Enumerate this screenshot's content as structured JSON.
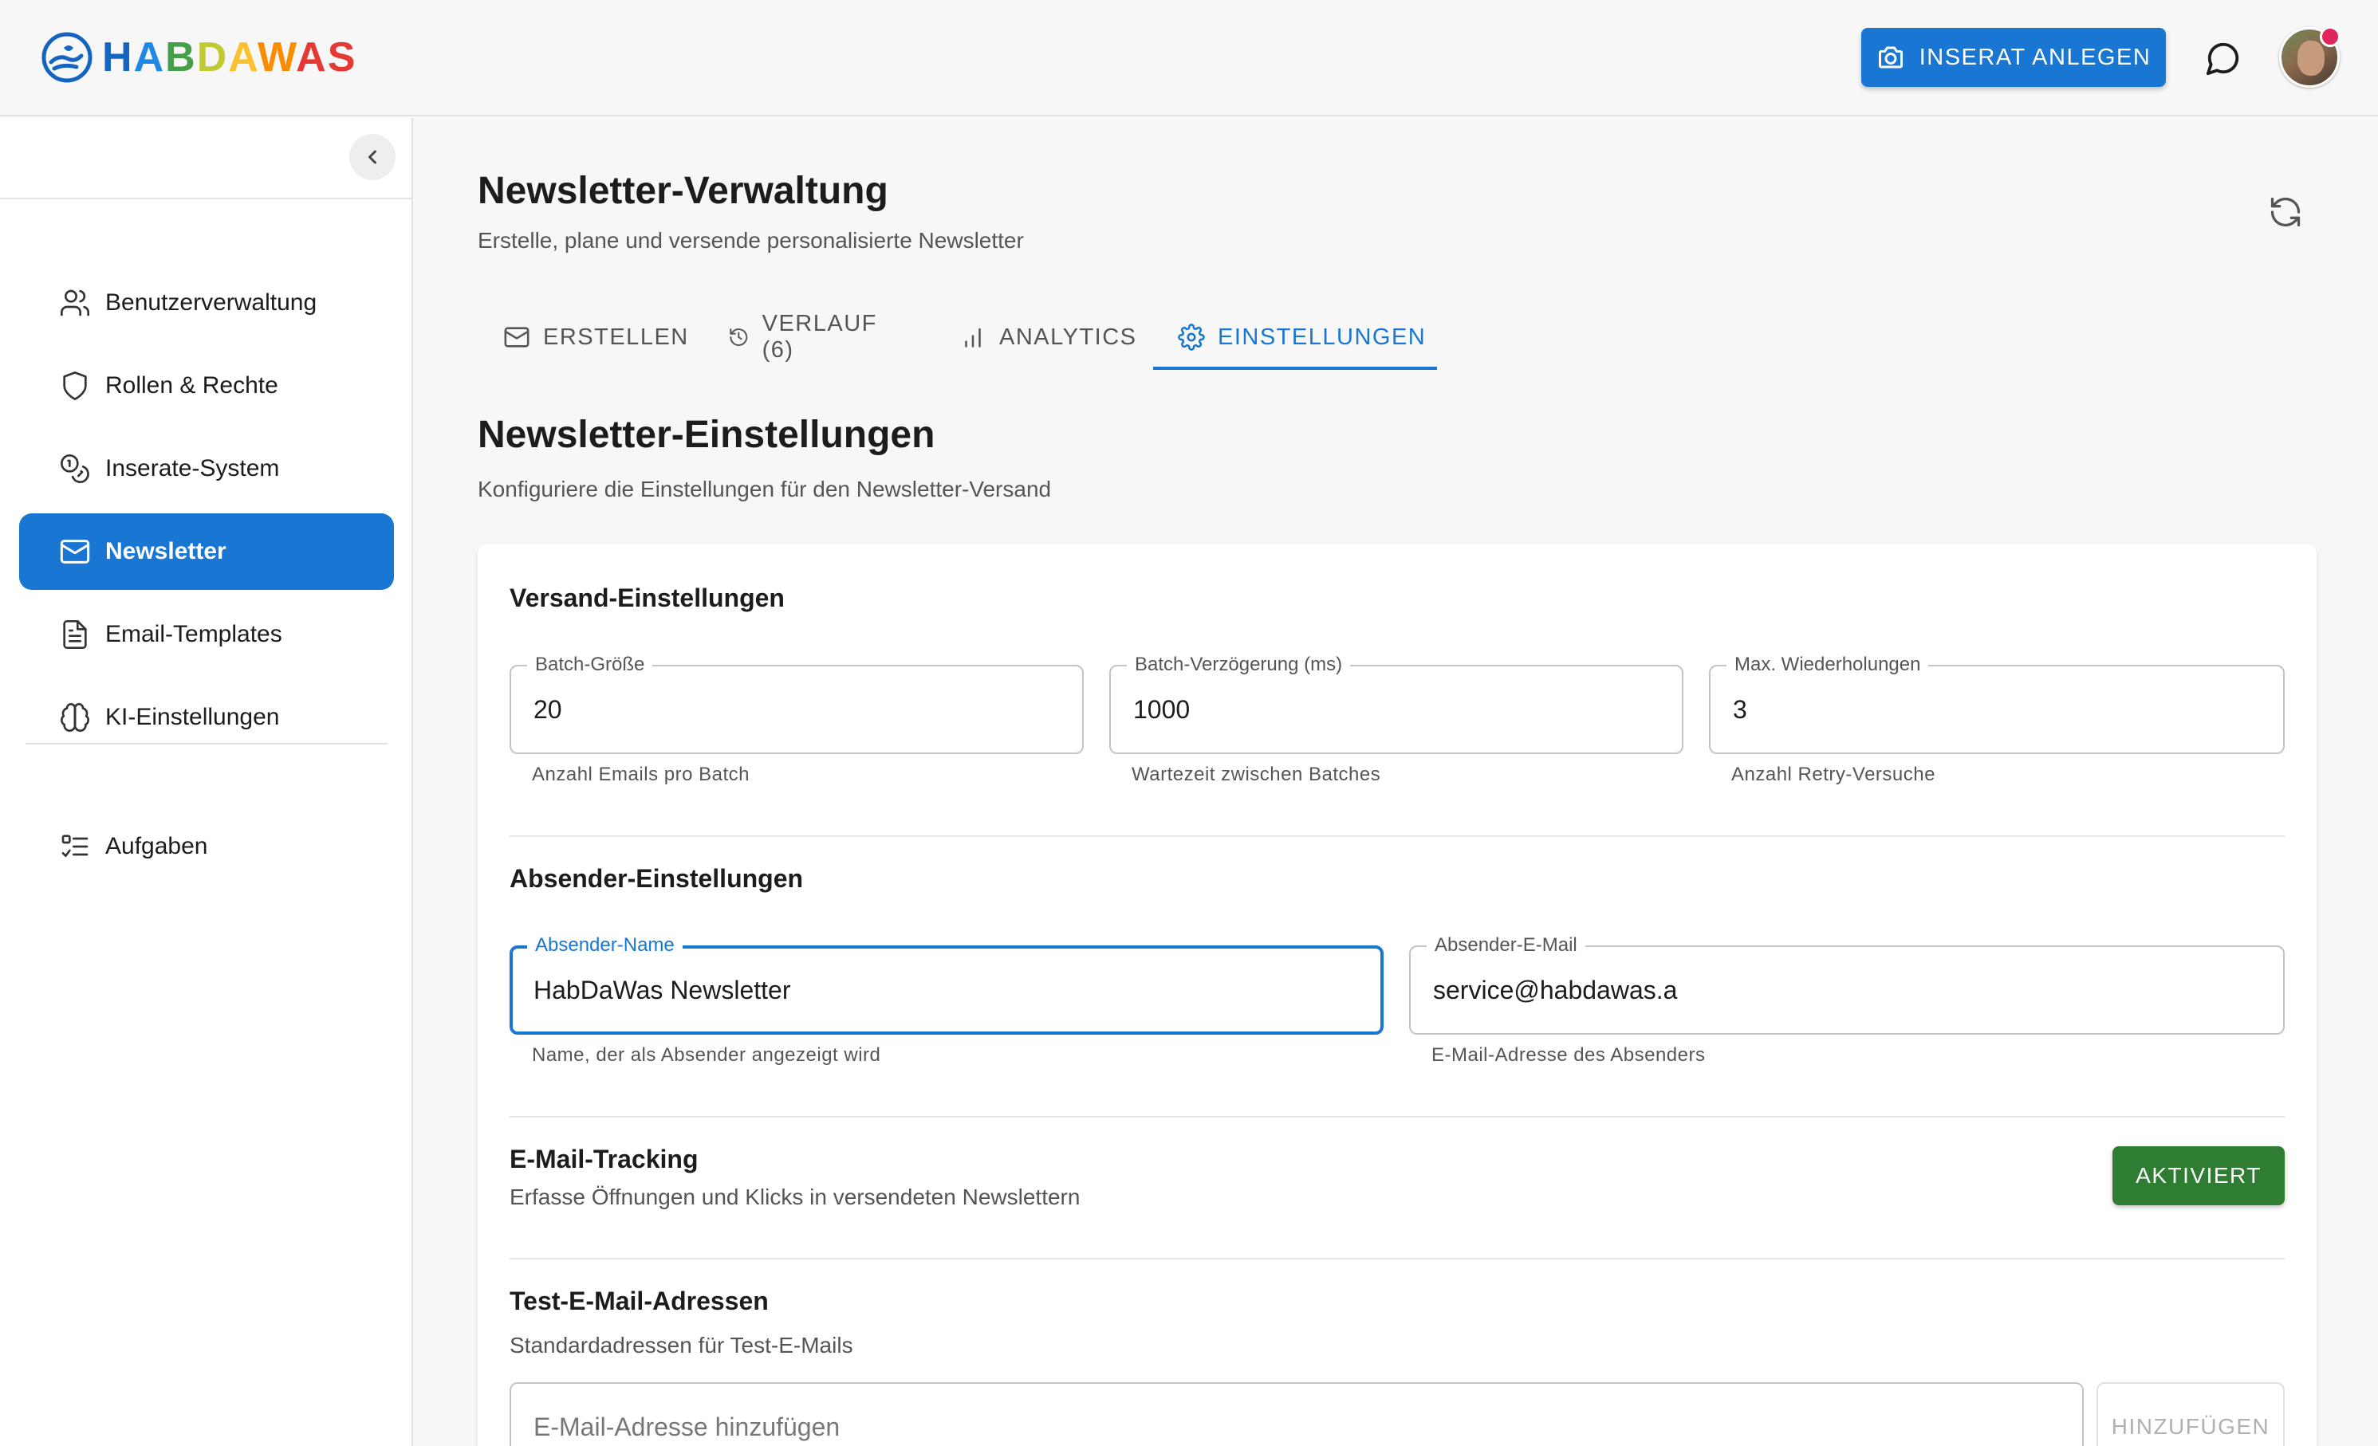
{
  "header": {
    "brand": "HABDAWAS",
    "brand_letters": [
      {
        "ch": "H",
        "color": "#1565c0"
      },
      {
        "ch": "A",
        "color": "#1e88e5"
      },
      {
        "ch": "B",
        "color": "#43a047"
      },
      {
        "ch": "D",
        "color": "#c0ca33"
      },
      {
        "ch": "A",
        "color": "#fbc02d"
      },
      {
        "ch": "W",
        "color": "#fb8c00"
      },
      {
        "ch": "A",
        "color": "#e53935"
      },
      {
        "ch": "S",
        "color": "#e53935"
      }
    ],
    "create_listing_label": "INSERAT ANLEGEN"
  },
  "sidebar": {
    "items": [
      {
        "label": "Benutzerverwaltung",
        "icon": "users-icon"
      },
      {
        "label": "Rollen & Rechte",
        "icon": "shield-icon"
      },
      {
        "label": "Inserate-System",
        "icon": "coins-icon"
      },
      {
        "label": "Newsletter",
        "icon": "mail-icon",
        "active": true
      },
      {
        "label": "Email-Templates",
        "icon": "document-icon"
      },
      {
        "label": "KI-Einstellungen",
        "icon": "brain-icon"
      },
      {
        "label": "Aufgaben",
        "icon": "checklist-icon"
      }
    ]
  },
  "main": {
    "title": "Newsletter-Verwaltung",
    "subtitle": "Erstelle, plane und versende personalisierte Newsletter",
    "tabs": [
      {
        "label": "ERSTELLEN",
        "icon": "mail-icon"
      },
      {
        "label": "VERLAUF (6)",
        "icon": "history-icon"
      },
      {
        "label": "ANALYTICS",
        "icon": "bar-chart-icon"
      },
      {
        "label": "EINSTELLUNGEN",
        "icon": "gear-icon",
        "active": true
      }
    ],
    "settings_title": "Newsletter-Einstellungen",
    "settings_subtitle": "Konfiguriere die Einstellungen für den Newsletter-Versand"
  },
  "versand": {
    "title": "Versand-Einstellungen",
    "batch_size": {
      "label": "Batch-Größe",
      "value": "20",
      "helper": "Anzahl Emails pro Batch"
    },
    "batch_delay": {
      "label": "Batch-Verzögerung (ms)",
      "value": "1000",
      "helper": "Wartezeit zwischen Batches"
    },
    "max_retries": {
      "label": "Max. Wiederholungen",
      "value": "3",
      "helper": "Anzahl Retry-Versuche"
    }
  },
  "absender": {
    "title": "Absender-Einstellungen",
    "name": {
      "label": "Absender-Name",
      "value": "HabDaWas Newsletter",
      "helper": "Name, der als Absender angezeigt wird"
    },
    "email": {
      "label": "Absender-E-Mail",
      "value": "service@habdawas.a",
      "helper": "E-Mail-Adresse des Absenders"
    }
  },
  "tracking": {
    "title": "E-Mail-Tracking",
    "description": "Erfasse Öffnungen und Klicks in versendeten Newslettern",
    "status_label": "AKTIVIERT"
  },
  "test_emails": {
    "title": "Test-E-Mail-Adressen",
    "description": "Standardadressen für Test-E-Mails",
    "placeholder": "E-Mail-Adresse hinzufügen",
    "add_label": "HINZUFÜGEN"
  },
  "colors": {
    "primary": "#1976d2",
    "success": "#2e7d32"
  }
}
